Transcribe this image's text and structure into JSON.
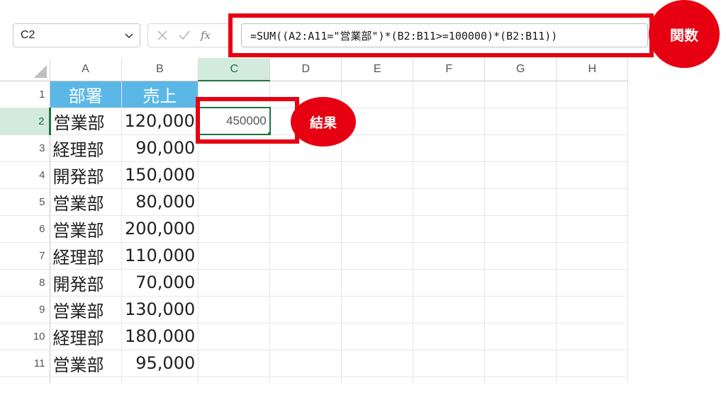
{
  "formula_bar": {
    "name_box": "C2",
    "fx_label": "fx",
    "formula": "=SUM((A2:A11=\"営業部\")*(B2:B11>=100000)*(B2:B11))"
  },
  "grid": {
    "columns": [
      "A",
      "B",
      "C",
      "D",
      "E",
      "F",
      "G",
      "H"
    ],
    "selected_column": "C",
    "selected_row": "2",
    "rows": [
      {
        "num": "1",
        "a": "部署",
        "b": "売上",
        "c": ""
      },
      {
        "num": "2",
        "a": "営業部",
        "b": "120,000",
        "c": "450000"
      },
      {
        "num": "3",
        "a": "経理部",
        "b": "90,000",
        "c": ""
      },
      {
        "num": "4",
        "a": "開発部",
        "b": "150,000",
        "c": ""
      },
      {
        "num": "5",
        "a": "営業部",
        "b": "80,000",
        "c": ""
      },
      {
        "num": "6",
        "a": "営業部",
        "b": "200,000",
        "c": ""
      },
      {
        "num": "7",
        "a": "経理部",
        "b": "110,000",
        "c": ""
      },
      {
        "num": "8",
        "a": "開発部",
        "b": "70,000",
        "c": ""
      },
      {
        "num": "9",
        "a": "営業部",
        "b": "130,000",
        "c": ""
      },
      {
        "num": "10",
        "a": "経理部",
        "b": "180,000",
        "c": ""
      },
      {
        "num": "11",
        "a": "営業部",
        "b": "95,000",
        "c": ""
      }
    ]
  },
  "callouts": {
    "formula": "関数",
    "result": "結果"
  },
  "colors": {
    "accent_red": "#e60012",
    "header_fill": "#5bb8e6",
    "selection_green": "#217346"
  }
}
